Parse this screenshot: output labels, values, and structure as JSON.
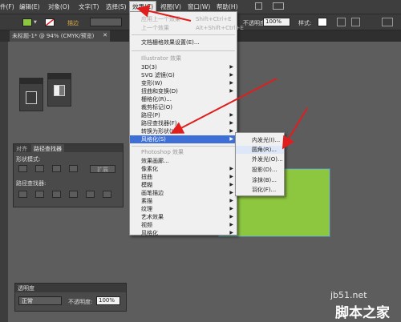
{
  "menubar": {
    "items": [
      "件(F)",
      "编辑(E)",
      "对象(O)",
      "文字(T)",
      "选择(S)",
      "效果(C)",
      "视图(V)",
      "窗口(W)",
      "帮助(H)"
    ]
  },
  "control_bar": {
    "stroke_label": "描边",
    "opacity_label": "不透明度",
    "opacity_value": "100%",
    "style_label": "样式:"
  },
  "document_tab": {
    "title": "未标题-1* @ 94% (CMYK/预览)"
  },
  "effect_menu": {
    "apply_last": {
      "label": "应用上一个效果",
      "shortcut": "Shift+Ctrl+E"
    },
    "last_effect": {
      "label": "上一个效果",
      "shortcut": "Alt+Shift+Ctrl+E"
    },
    "document_raster_settings": "文档栅格效果设置(E)...",
    "illustrator_header": "Illustrator 效果",
    "illustrator_items": [
      "3D(3)",
      "SVG 滤镜(G)",
      "变形(W)",
      "扭曲和变换(D)",
      "栅格化(R)...",
      "裁剪标记(O)",
      "路径(P)",
      "路径查找器(F)",
      "转换为形状(V)",
      "风格化(S)"
    ],
    "photoshop_header": "Photoshop 效果",
    "photoshop_items": [
      "效果画廊...",
      "像素化",
      "扭曲",
      "模糊",
      "画笔描边",
      "素描",
      "纹理",
      "艺术效果",
      "视频",
      "风格化"
    ]
  },
  "stylize_submenu": {
    "items": [
      "内发光(I)...",
      "圆角(R)...",
      "外发光(O)...",
      "投影(D)...",
      "涂抹(B)...",
      "羽化(F)..."
    ]
  },
  "pathfinder_panel": {
    "tabs": [
      "对齐",
      "路径查找器"
    ],
    "shape_modes_label": "形状模式:",
    "expand_button": "扩展",
    "pathfinders_label": "路径查找器:"
  },
  "transparency_panel": {
    "title": "透明度",
    "blend_mode": "正常",
    "opacity_label": "不透明度:",
    "opacity_value": "100%"
  },
  "colors": {
    "fill": "#8dc63f",
    "highlight": "#3d6fd6",
    "arrow": "#e01e1e"
  },
  "watermark": {
    "site": "jb51.net",
    "brand": "脚本之家"
  }
}
